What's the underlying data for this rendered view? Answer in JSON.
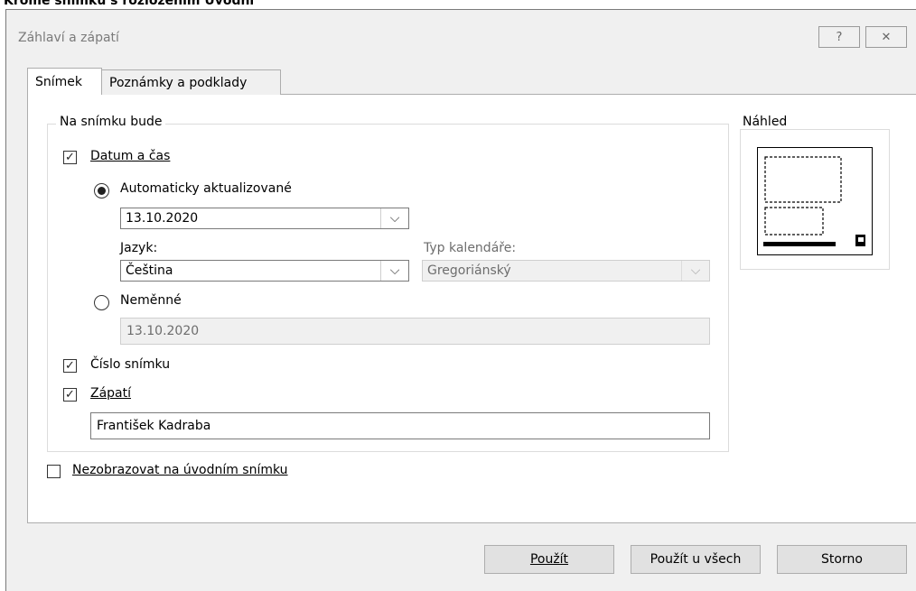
{
  "page_caption": "Kromě snímku s rozložením Úvodní",
  "dialog": {
    "title": "Záhlaví a zápatí",
    "help_glyph": "?",
    "close_glyph": "✕"
  },
  "tabs": [
    {
      "label": "Snímek",
      "active": true
    },
    {
      "label": "Poznámky a podklady",
      "active": false
    }
  ],
  "slide_group": {
    "legend": "Na snímku bude",
    "date_time": {
      "label": "Datum a čas",
      "checked": true
    },
    "auto_update": {
      "label": "Automaticky aktualizované",
      "selected": true,
      "date_value": "13.10.2020",
      "language_label": "Jazyk:",
      "language_value": "Čeština",
      "calendar_label": "Typ kalendáře:",
      "calendar_value": "Gregoriánský"
    },
    "fixed": {
      "label": "Neměnné",
      "selected": false,
      "value": "13.10.2020"
    },
    "slide_number": {
      "label": "Číslo snímku",
      "checked": true
    },
    "footer": {
      "label": "Zápatí",
      "checked": true,
      "value": "František Kadraba"
    }
  },
  "dont_show_title": {
    "label": "Nezobrazovat na úvodním snímku",
    "checked": false
  },
  "preview": {
    "legend": "Náhled"
  },
  "buttons": {
    "apply": "Použít",
    "apply_all": "Použít u všech",
    "cancel": "Storno"
  },
  "glyphs": {
    "check": "✓",
    "chevron": "⌵"
  }
}
